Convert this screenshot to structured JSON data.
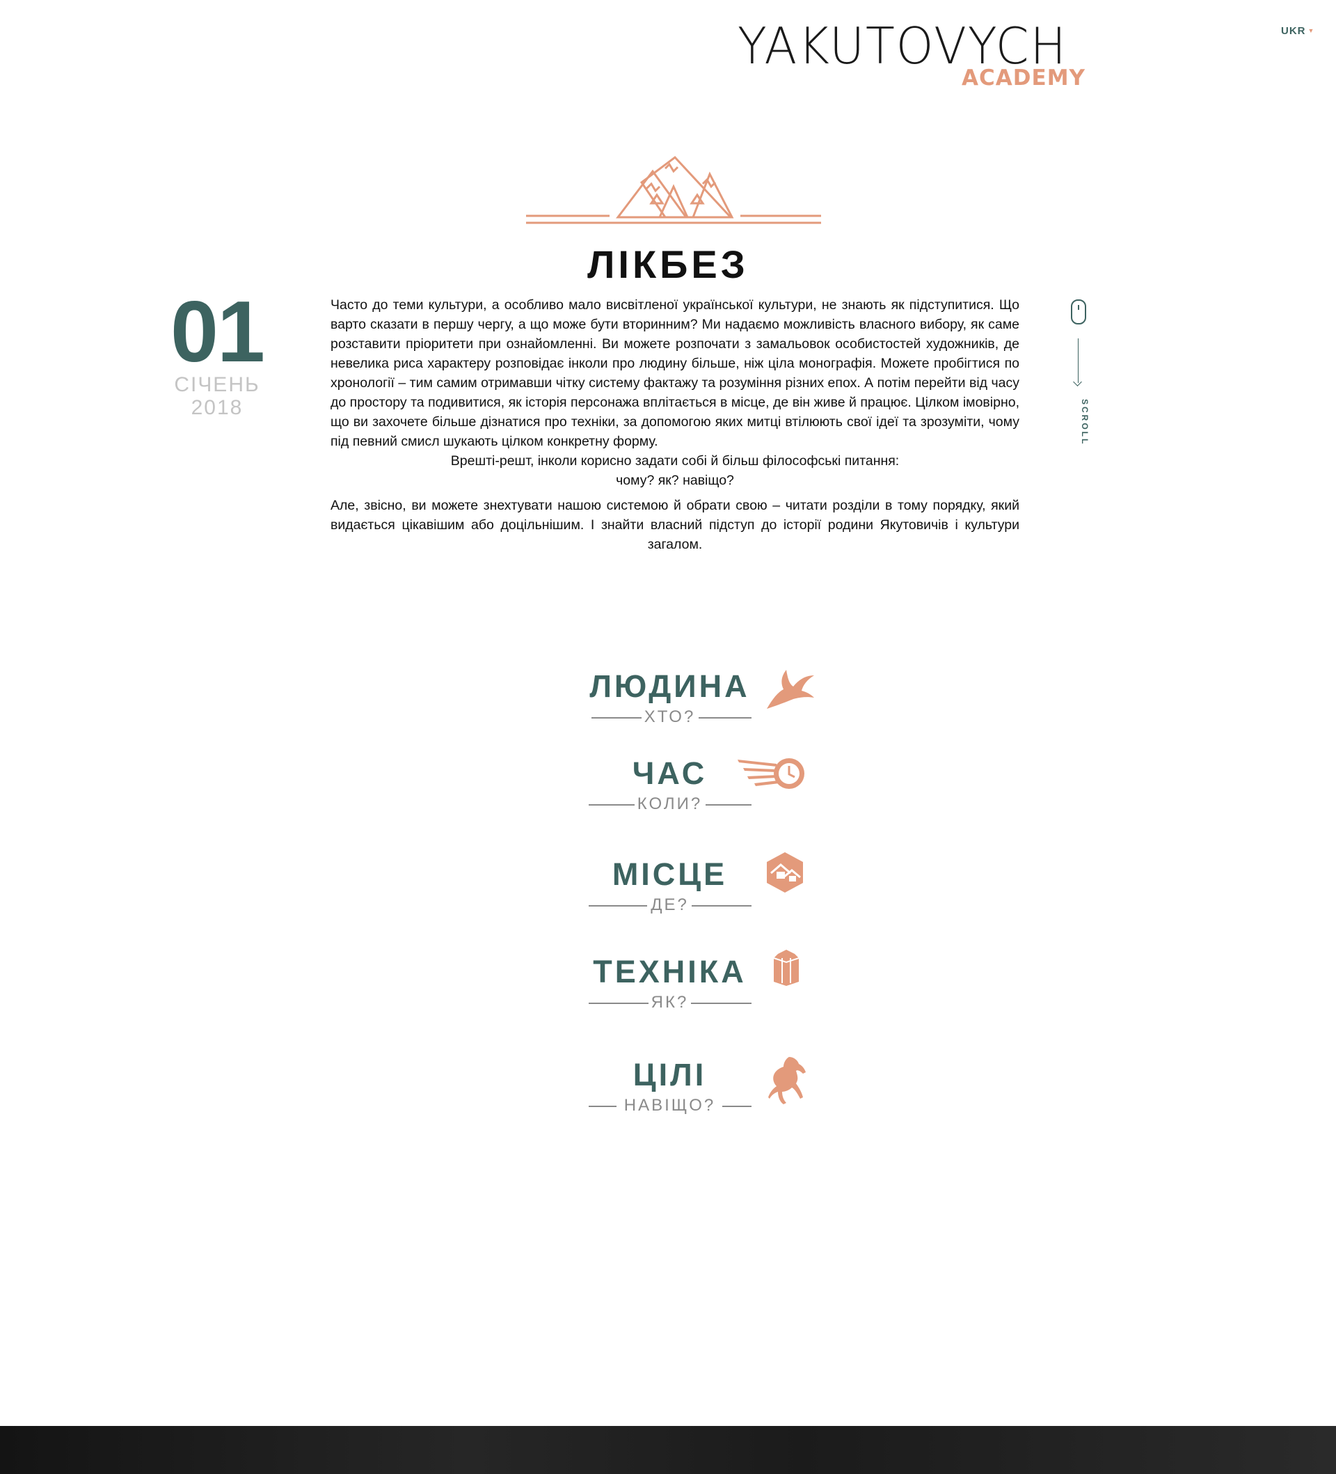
{
  "header": {
    "logo_main": "YAKUTOVYCH",
    "logo_sub": "ACADEMY",
    "language": "UKR"
  },
  "page": {
    "title": "ЛІКБЕЗ"
  },
  "date": {
    "day": "01",
    "month": "СІЧЕНЬ",
    "year": "2018"
  },
  "intro": {
    "paragraph1": "Часто до теми культури, а особливо мало висвітленої української культури, не знають як підступитися. Що варто сказати в першу чергу, а що може бути вторинним? Ми надаємо можливість власного вибору, як саме розставити пріоритети при ознайомленні. Ви можете розпочати з замальовок особистостей художників, де невелика риса характеру розповідає інколи про людину більше, ніж ціла монографія. Можете пробігтися по хронології – тим самим отримавши чітку систему фактажу та розуміння різних епох. А потім перейти від часу до простору та подивитися, як історія персонажа вплітається в місце, де він живе й працює. Цілком імовірно, що ви захочете більше дізнатися про техніки, за допомогою яких митці втілюють свої ідеї та зрозуміти, чому під певний смисл шукають цілком конкретну форму.",
    "line_philosophy": "Врешті-решт, інколи корисно задати собі й більш філософські питання:",
    "line_questions": "чому? як? навіщо?",
    "paragraph2": "Але, звісно, ви можете знехтувати нашою системою й обрати свою – читати розділи в тому порядку, який видається цікавішим або доцільнішим. І знайти власний підступ до історії родини Якутовичів і культури загалом."
  },
  "scroll": {
    "label": "SCROLL"
  },
  "categories": [
    {
      "title": "ЛЮДИНА",
      "subtitle": "ХТО?",
      "icon": "swallow-icon"
    },
    {
      "title": "ЧАС",
      "subtitle": "КОЛИ?",
      "icon": "clock-icon"
    },
    {
      "title": "МІСЦЕ",
      "subtitle": "ДЕ?",
      "icon": "houses-icon"
    },
    {
      "title": "ТЕХНІКА",
      "subtitle": "ЯК?",
      "icon": "crystal-icon"
    },
    {
      "title": "ЦІЛІ",
      "subtitle": "НАВІЩО?",
      "icon": "horse-icon"
    }
  ],
  "colors": {
    "accent": "#e39a7b",
    "primary": "#3d6360",
    "muted": "#8a8a8a"
  }
}
